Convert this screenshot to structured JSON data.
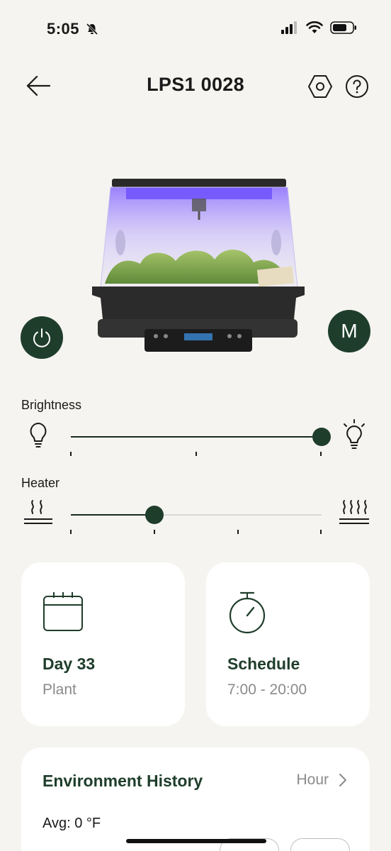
{
  "status_bar": {
    "time": "5:05"
  },
  "header": {
    "title": "LPS1 0028"
  },
  "brightness": {
    "label": "Brightness",
    "value": 1.0,
    "ticks": 3
  },
  "heater": {
    "label": "Heater",
    "value": 0.333,
    "ticks": 4
  },
  "cards": {
    "day": {
      "title": "Day 33",
      "subtitle": "Plant"
    },
    "schedule": {
      "title": "Schedule",
      "subtitle": "7:00 - 20:00"
    }
  },
  "environment": {
    "title": "Environment History",
    "period": "Hour",
    "avg": "Avg: 0 °F"
  },
  "colors": {
    "accent": "#1f3d2b",
    "background": "#f5f4f0",
    "card": "#ffffff",
    "muted_text": "#8a8a8a"
  },
  "icons": {
    "back": "arrow-left-icon",
    "settings": "hexagon-settings-icon",
    "help": "question-circle-icon",
    "power": "power-icon",
    "mode": "M",
    "brightness_low": "bulb-off-icon",
    "brightness_high": "bulb-on-icon",
    "heater_low": "heat-low-icon",
    "heater_high": "heat-high-icon",
    "calendar": "calendar-icon",
    "timer": "stopwatch-icon",
    "chevron": "chevron-right-icon"
  }
}
